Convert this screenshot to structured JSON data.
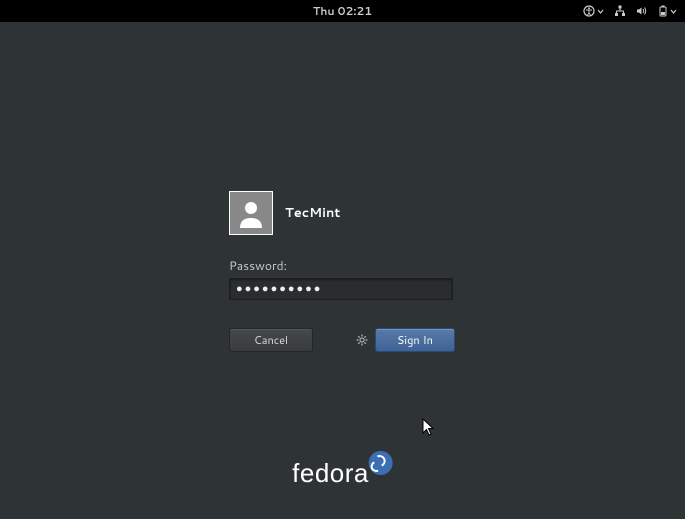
{
  "panel": {
    "clock": "Thu 02:21"
  },
  "login": {
    "username": "TecMint",
    "password_label": "Password:",
    "password_value": "●●●●●●●●●●",
    "cancel_label": "Cancel",
    "signin_label": "Sign In"
  },
  "brand": {
    "name": "fedora"
  }
}
